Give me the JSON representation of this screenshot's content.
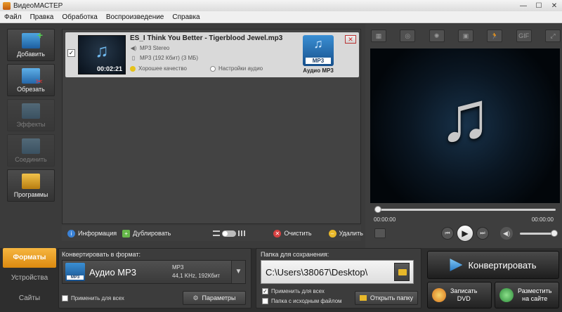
{
  "window": {
    "title": "ВидеоМАСТЕР",
    "minimize": "—",
    "maximize": "☐",
    "close": "✕"
  },
  "menu": [
    "Файл",
    "Правка",
    "Обработка",
    "Воспроизведение",
    "Справка"
  ],
  "left_toolbar": [
    {
      "label": "Добавить",
      "enabled": true
    },
    {
      "label": "Обрезать",
      "enabled": true
    },
    {
      "label": "Эффекты",
      "enabled": false
    },
    {
      "label": "Соединить",
      "enabled": false
    },
    {
      "label": "Программы",
      "enabled": true
    }
  ],
  "file_item": {
    "checked": "✓",
    "name": "ES_I Think You Better - Tigerblood Jewel.mp3",
    "duration": "00:02:21",
    "audio": "MP3 Stereo",
    "size": "MP3 (192 Кбит) (3 МБ)",
    "quality": "Хорошее качество",
    "audio_settings": "Настройки аудио",
    "format_badge": "MP3",
    "format_name": "Аудио MP3",
    "close": "✕"
  },
  "list_toolbar": {
    "info": "Информация",
    "duplicate": "Дублировать",
    "clear": "Очистить",
    "delete": "Удалить"
  },
  "preview": {
    "tools": [
      "▦",
      "◎",
      "✺",
      "▣",
      "🏃",
      "GIF",
      "⤢"
    ],
    "time_left": "00:00:00",
    "time_right": "00:00:00",
    "seek_fraction": 0.0,
    "volume_fraction": 1.0
  },
  "side_tabs": [
    {
      "label": "Форматы",
      "active": true
    },
    {
      "label": "Устройства",
      "active": false
    },
    {
      "label": "Сайты",
      "active": false
    }
  ],
  "convert_to": {
    "label": "Конвертировать в формат:",
    "format": "Аудио MP3",
    "codec": "MP3",
    "params": "44,1 KHz, 192Кбит",
    "apply_all": "Применить для всех",
    "params_button": "Параметры"
  },
  "save_folder": {
    "label": "Папка для сохранения:",
    "path": "C:\\Users\\38067\\Desktop\\",
    "apply_all": "Применить для всех",
    "apply_all_checked": "✓",
    "source_folder": "Папка с исходным файлом",
    "open_folder": "Открыть папку"
  },
  "actions": {
    "convert": "Конвертировать",
    "dvd_line1": "Записать",
    "dvd_line2": "DVD",
    "web_line1": "Разместить",
    "web_line2": "на сайте"
  }
}
